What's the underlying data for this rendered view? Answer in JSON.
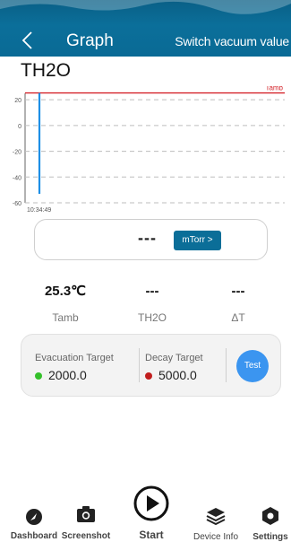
{
  "header": {
    "title": "Graph",
    "switch_label": "Switch vacuum value",
    "bg_color": "#0b6e98"
  },
  "page_title": "TH2O",
  "chart_data": {
    "type": "line",
    "y_ticks": [
      "20",
      "0",
      "-20",
      "-40",
      "-60"
    ],
    "ylim": [
      -60,
      25
    ],
    "x_ticks": [
      "10:34:49"
    ],
    "reference_lines": [
      {
        "label": "Tamb",
        "value": 25.3,
        "color": "#d4232a"
      }
    ],
    "series": [
      {
        "color": "#1e8fe6",
        "values": [
          {
            "x": "10:34:49",
            "y_from": 25.3,
            "y_to": -53
          }
        ]
      }
    ],
    "grid": "dashed-horizontal"
  },
  "vacuum": {
    "value": "---",
    "unit_button": "mTorr >"
  },
  "metrics": [
    {
      "value": "25.3℃",
      "label": "Tamb"
    },
    {
      "value": "---",
      "label": "TH2O"
    },
    {
      "value": "---",
      "label": "ΔT"
    }
  ],
  "targets": {
    "evacuation_label": "Evacuation Target",
    "evacuation_value": "2000.0",
    "evacuation_color": "#34c02a",
    "decay_label": "Decay Target",
    "decay_value": "5000.0",
    "decay_color": "#c11e1e",
    "test_button": "Test"
  },
  "nav": {
    "dashboard": "Dashboard",
    "screenshot": "Screenshot",
    "start": "Start",
    "device_info": "Device Info",
    "settings": "Settings"
  }
}
